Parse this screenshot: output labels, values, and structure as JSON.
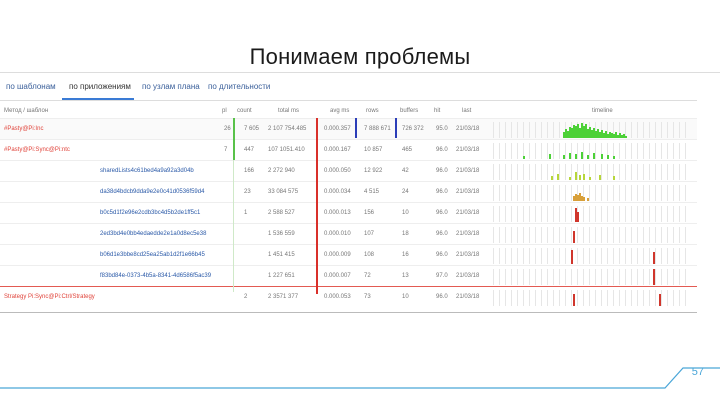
{
  "slide": {
    "title": "Понимаем проблемы",
    "page_number": "57"
  },
  "tabs": [
    {
      "label": "по шаблонам",
      "active": false
    },
    {
      "label": "по приложениям",
      "active": true
    },
    {
      "label": "по узлам плана",
      "active": false
    },
    {
      "label": "по длительности",
      "active": false
    }
  ],
  "table": {
    "headers": {
      "name": "Метод / шаблон",
      "pl": "pl",
      "count": "count",
      "total": "total ms",
      "avg": "avg ms",
      "rows": "rows",
      "buffers": "buffers",
      "hit": "hit",
      "last": "last",
      "timeline": "timeline"
    },
    "rows": [
      {
        "name": "#Pasty@Pi:Inc",
        "name_color": "red",
        "pl": "26",
        "count": "7 605",
        "total": "2 107 754.485",
        "avg": "0.000.357",
        "rows": "7 888 671",
        "buffers": "726 372",
        "hit": "95.0",
        "last": "21/03/18"
      },
      {
        "name": "#Pasty@Pi:Sync@Pi:ntc",
        "name_color": "red",
        "pl": "7",
        "count": "447",
        "total": "107 1051.410",
        "avg": "0.000.167",
        "rows": "10 857",
        "buffers": "465",
        "hit": "96.0",
        "last": "21/03/18"
      },
      {
        "name": "sharedLists4c61bed4a9a92a3d04b",
        "name_color": "blue",
        "pl": "",
        "count": "166",
        "total": "2 272 940",
        "avg": "0.000.050",
        "rows": "12 922",
        "buffers": "42",
        "hit": "96.0",
        "last": "21/03/18"
      },
      {
        "name": "da38d4bdcb9dda9e2e0c41d0536f59d4",
        "name_color": "blue",
        "pl": "",
        "count": "23",
        "total": "33 084 575",
        "avg": "0.000.034",
        "rows": "4 515",
        "buffers": "24",
        "hit": "96.0",
        "last": "21/03/18"
      },
      {
        "name": "b0c5d1f2e96e2cdb3bc4d5b2de1ff5c1",
        "name_color": "blue",
        "pl": "",
        "count": "1",
        "total": "2 588 527",
        "avg": "0.000.013",
        "rows": "156",
        "buffers": "10",
        "hit": "96.0",
        "last": "21/03/18"
      },
      {
        "name": "2ed3bd4e0bb4edaedde2e1a0d8ec5e38",
        "name_color": "blue",
        "pl": "",
        "count": "",
        "total": "1 536 559",
        "avg": "0.000.010",
        "rows": "107",
        "buffers": "18",
        "hit": "96.0",
        "last": "21/03/18"
      },
      {
        "name": "b06d1e3bbe8cd25ea25ab1d2f1e66b45",
        "name_color": "blue",
        "pl": "",
        "count": "",
        "total": "1 451 415",
        "avg": "0.000.009",
        "rows": "108",
        "buffers": "16",
        "hit": "96.0",
        "last": "21/03/18"
      },
      {
        "name": "f83bd84e-0373-4b5a-8341-4d6586f5ac39",
        "name_color": "blue",
        "pl": "",
        "count": "",
        "total": "1 227 651",
        "avg": "0.000.007",
        "rows": "72",
        "buffers": "13",
        "hit": "97.0",
        "last": "21/03/18"
      },
      {
        "name": "Strategy Pi:Sync@Pi:Ctrl/Strategy",
        "name_color": "red",
        "pl": "",
        "count": "2",
        "total": "2 3571 377",
        "avg": "0.000.053",
        "rows": "73",
        "buffers": "10",
        "hit": "96.0",
        "last": "21/03/18"
      }
    ]
  },
  "colors": {
    "accent_blue": "#3a7bd5",
    "bar_green": "#4cd137",
    "bar_yellowgreen": "#b7d63a",
    "bar_red": "#d0362c",
    "sep_green": "#59c24a",
    "sep_red": "#d9302a",
    "sep_blue": "#2b3db8",
    "page_num": "#4aa6d8"
  }
}
